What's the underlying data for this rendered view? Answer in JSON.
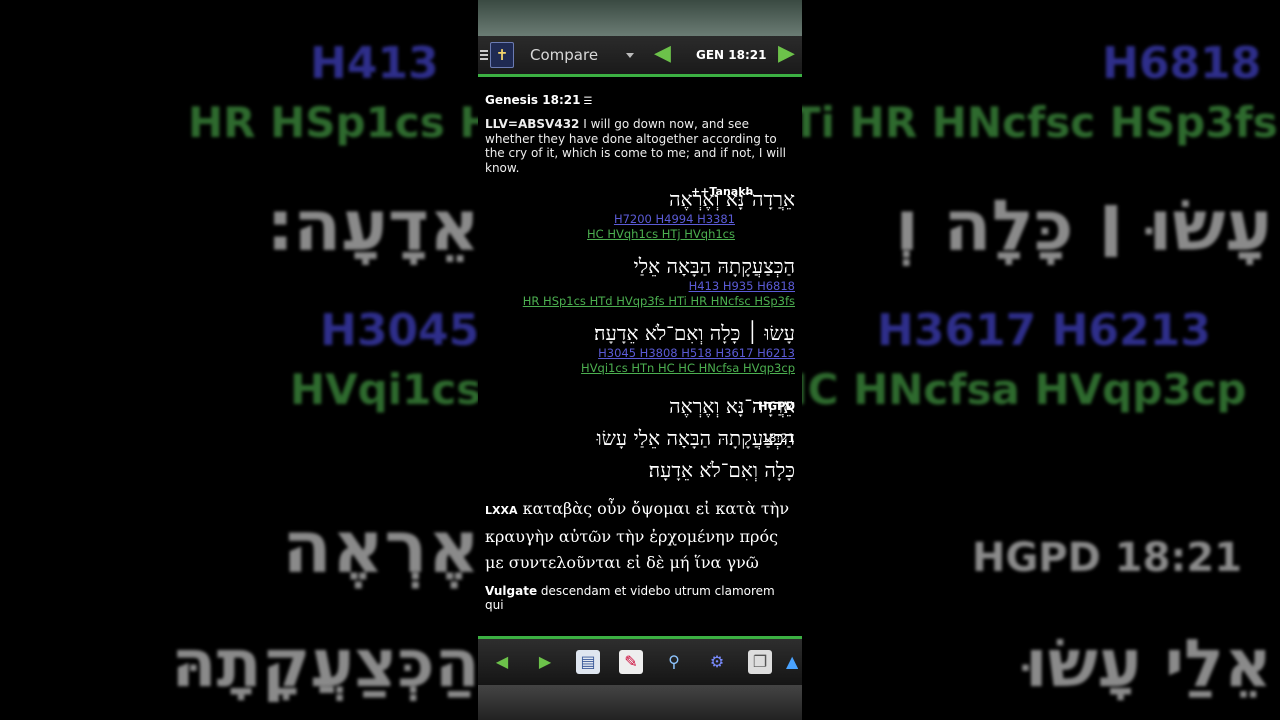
{
  "app": {
    "view_mode": "Compare",
    "reference": "GEN 18:21",
    "icons": [
      "menu-icon",
      "bible-book-icon",
      "prev-arrow-icon",
      "next-arrow-icon"
    ]
  },
  "passage": {
    "heading": "Genesis 18:21",
    "llv_label": "LLV=ABSV432",
    "llv_text": "I will go down now, and see whether they have done altogether according to the cry of it, which is come to me; and if not, I will know.",
    "tanakh_label": "++Tanakh",
    "lines": [
      {
        "hebrew": "אֵרֲדָה־נָּא וְאֶרְאֶה",
        "blue_codes": "H7200 H4994 H3381",
        "green_codes": "HC HVqh1cs HTj HVqh1cs"
      },
      {
        "hebrew": "הַכְּצַעֲקָתָהּ הַבָּאָה אֵלַי",
        "blue_codes": "H413 H935 H6818",
        "green_codes": "HR HSp1cs HTd HVqp3fs HTi HR HNcfsc HSp3fs"
      },
      {
        "hebrew": "עָשׂוּ ׀ כָּלָה וְאִם־לֹא אֵדָעָה׃",
        "blue_codes": "H3045 H3808 H518 H3617 H6213",
        "green_codes": "HVqi1cs HTn HC HC HNcfsa HVqp3cp"
      }
    ],
    "hgpd_label": "HGPD",
    "hgpd_ref": "18:21",
    "hgpd_lines": [
      "אֵרֲדָה־נָּא וְאֶרְאֶה",
      "הַכְּצַעֲקָתָהּ הַבָּאָה אֵלַי עָשׂוּ",
      "כָּלָה וְאִם־לֹא אֵדָעָה׃"
    ],
    "lxx_label": "LXXA",
    "lxx_text": "καταβὰς οὖν ὄψομαι εἰ κατὰ τὴν κραυγὴν αὐτῶν τὴν ἐρχομένην πρός με συντελοῦνται εἰ δὲ μή ἵνα γνῶ",
    "vulgate_label": "Vulgate",
    "vulgate_text": "descendam et videbo utrum clamorem qui"
  },
  "bottom_toolbar": [
    "back-icon",
    "forward-icon",
    "notes-icon",
    "edit-icon",
    "search-icon",
    "settings-icon",
    "copy-icon",
    "up-icon"
  ],
  "background": {
    "codes_top": "H413",
    "codes_top_right": "H6818",
    "green_row": "HR HSp1cs H",
    "green_row_right": "Ti HR HNcfsc HSp3fs",
    "heb_left": "עָשׂוּ ׀ כָּלָה וְ",
    "heb_right": "אֵדָעָה׃",
    "codes_mid_left": "H3045",
    "codes_mid_right": "H3617 H6213",
    "green_mid_left": "HVqi1cs",
    "green_mid_right": "IC HNcfsa HVqp3cp",
    "heb2": "אֶרְאֶה",
    "hgpd_bg": "HGPD 18:21",
    "heb3": "הַכְּצַעֲקָתָהּ",
    "heb3_right": "אֵלַי עָשׂוּ"
  },
  "colors": {
    "accent": "#3cb043",
    "link_blue": "#5b5bd6",
    "link_green": "#4caf50"
  }
}
